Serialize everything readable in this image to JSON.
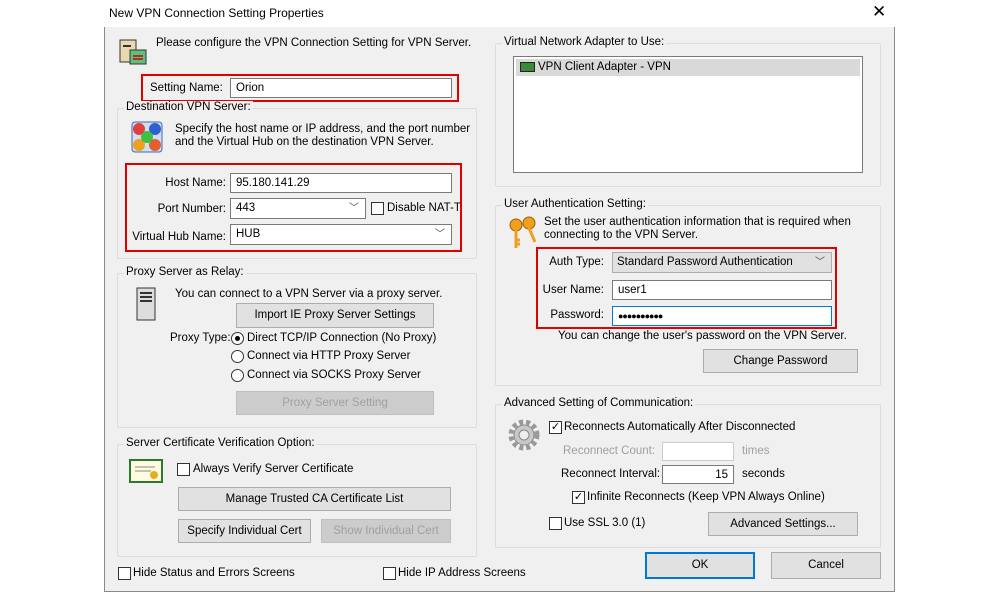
{
  "window": {
    "title": "New VPN Connection Setting Properties",
    "close_icon": "close-icon"
  },
  "intro": "Please configure the VPN Connection Setting for VPN Server.",
  "setting_name": {
    "label": "Setting Name:",
    "value": "Orion"
  },
  "destination": {
    "group_label": "Destination VPN Server:",
    "desc1": "Specify the host name or IP address, and the port number",
    "desc2": "and the Virtual Hub on the destination VPN Server.",
    "host_label": "Host Name:",
    "host_value": "95.180.141.29",
    "port_label": "Port Number:",
    "port_value": "443",
    "disable_natt": "Disable NAT-T",
    "hub_label": "Virtual Hub Name:",
    "hub_value": "HUB"
  },
  "proxy": {
    "group_label": "Proxy Server as Relay:",
    "desc": "You can connect to a VPN Server via a proxy server.",
    "import_button": "Import IE Proxy Server Settings",
    "type_label": "Proxy Type:",
    "options": [
      "Direct TCP/IP Connection (No Proxy)",
      "Connect via HTTP Proxy Server",
      "Connect via SOCKS Proxy Server"
    ],
    "selected": 0,
    "setting_button": "Proxy Server Setting"
  },
  "cert": {
    "group_label": "Server Certificate Verification Option:",
    "always_verify": "Always Verify Server Certificate",
    "manage_button": "Manage Trusted CA Certificate List",
    "specify_button": "Specify Individual Cert",
    "show_button": "Show Individual Cert"
  },
  "bottom": {
    "hide_status": "Hide Status and Errors Screens",
    "hide_ip": "Hide IP Address Screens",
    "ok": "OK",
    "cancel": "Cancel"
  },
  "adapter": {
    "group_label": "Virtual Network Adapter to Use:",
    "items": [
      "VPN Client Adapter - VPN"
    ]
  },
  "auth": {
    "group_label": "User Authentication Setting:",
    "desc1": "Set the user authentication information that is required when",
    "desc2": "connecting to the VPN Server.",
    "type_label": "Auth Type:",
    "type_value": "Standard Password Authentication",
    "user_label": "User Name:",
    "user_value": "user1",
    "password_label": "Password:",
    "password_value": "●●●●●●●●●●",
    "note": "You can change the user's password on the VPN Server.",
    "change_button": "Change Password"
  },
  "advanced": {
    "group_label": "Advanced Setting of Communication:",
    "reconnect_auto": "Reconnects Automatically After Disconnected",
    "count_label": "Reconnect Count:",
    "count_value": "",
    "count_unit": "times",
    "interval_label": "Reconnect Interval:",
    "interval_value": "15",
    "interval_unit": "seconds",
    "infinite": "Infinite Reconnects (Keep VPN Always Online)",
    "ssl3": "Use SSL 3.0 (1)",
    "advanced_button": "Advanced Settings..."
  }
}
